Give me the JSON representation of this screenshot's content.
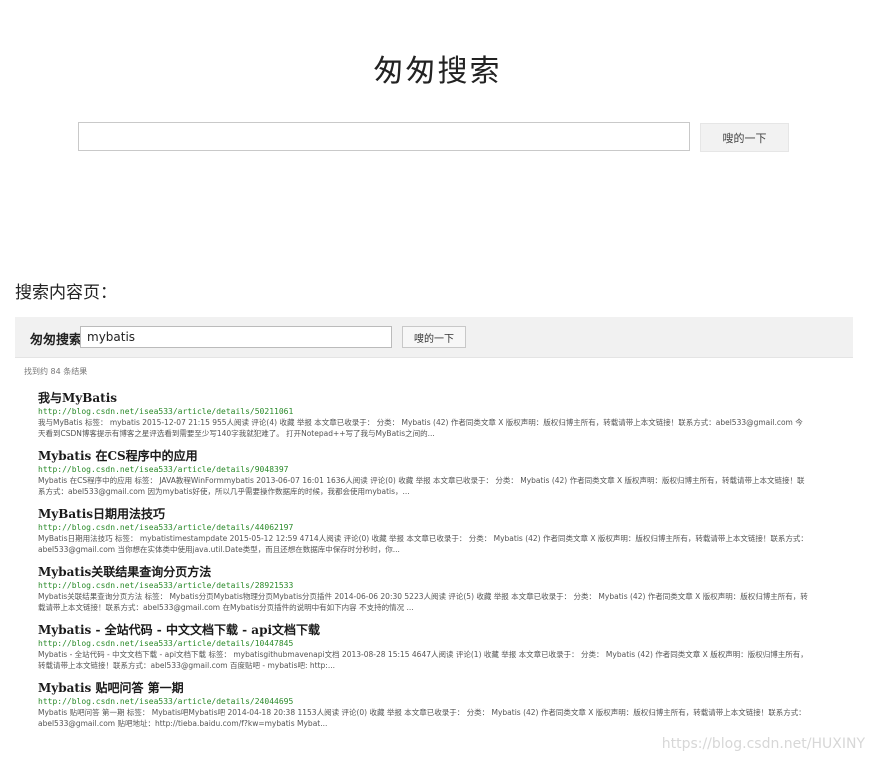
{
  "home": {
    "title": "匆匆搜索",
    "search_value": "",
    "button_label": "嗖的一下"
  },
  "section_heading": "搜索内容页：",
  "results_page": {
    "logo": "匆匆搜索",
    "query": "mybatis",
    "button_label": "嗖的一下",
    "count_text": "找到约 84 条结果",
    "results": [
      {
        "title": "我与MyBatis",
        "url": "http://blog.csdn.net/isea533/article/details/50211061",
        "snippet": "我与MyBatis 标签： mybatis 2015-12-07 21:15 955人阅读 评论(4) 收藏 举报 本文章已收录于： 分类： Mybatis (42) 作者同类文章 X 版权声明：版权归博主所有，转载请带上本文链接！联系方式：abel533@gmail.com 今天看到CSDN博客提示有博客之星评选看到需要至少写140字我就犯难了。 打开Notepad++写了我与MyBatis之间的..."
      },
      {
        "title": "Mybatis 在CS程序中的应用",
        "url": "http://blog.csdn.net/isea533/article/details/9048397",
        "snippet": "Mybatis 在CS程序中的应用 标签： JAVA教程WinFormmybatis 2013-06-07 16:01 1636人阅读 评论(0) 收藏 举报 本文章已收录于： 分类： Mybatis (42) 作者同类文章 X 版权声明：版权归博主所有，转载请带上本文链接！联系方式：abel533@gmail.com 因为mybatis好使，所以几乎需要操作数据库的时候，我都会使用mybatis，..."
      },
      {
        "title": "MyBatis日期用法技巧",
        "url": "http://blog.csdn.net/isea533/article/details/44062197",
        "snippet": "MyBatis日期用法技巧 标签： mybatistimestampdate 2015-05-12 12:59 4714人阅读 评论(0) 收藏 举报 本文章已收录于： 分类： Mybatis (42) 作者同类文章 X 版权声明：版权归博主所有，转载请带上本文链接！联系方式：abel533@gmail.com 当你想在实体类中使用java.util.Date类型，而且还想在数据库中保存时分秒时，你..."
      },
      {
        "title": "Mybatis关联结果查询分页方法",
        "url": "http://blog.csdn.net/isea533/article/details/28921533",
        "snippet": "Mybatis关联结果查询分页方法 标签： Mybatis分页Mybatis物理分页Mybatis分页插件 2014-06-06 20:30 5223人阅读 评论(5) 收藏 举报 本文章已收录于： 分类： Mybatis (42) 作者同类文章 X 版权声明：版权归博主所有，转载请带上本文链接！联系方式：abel533@gmail.com 在Mybatis分页插件的说明中有如下内容 不支持的情况 ..."
      },
      {
        "title": "Mybatis - 全站代码 - 中文文档下载 - api文档下载",
        "url": "http://blog.csdn.net/isea533/article/details/10447845",
        "snippet": "Mybatis - 全站代码 - 中文文档下载 - api文档下载 标签： mybatisgithubmavenapi文档 2013-08-28 15:15 4647人阅读 评论(1) 收藏 举报 本文章已收录于： 分类： Mybatis (42) 作者同类文章 X 版权声明：版权归博主所有，转载请带上本文链接！联系方式：abel533@gmail.com 百度贴吧 - mybatis吧: http:..."
      },
      {
        "title": "Mybatis 贴吧问答 第一期",
        "url": "http://blog.csdn.net/isea533/article/details/24044695",
        "snippet": "Mybatis 贴吧问答 第一期 标签： Mybatis吧Mybatis吧 2014-04-18 20:38 1153人阅读 评论(0) 收藏 举报 本文章已收录于： 分类： Mybatis (42) 作者同类文章 X 版权声明：版权归博主所有，转载请带上本文链接！联系方式：abel533@gmail.com 贴吧地址：http://tieba.baidu.com/f?kw=mybatis Mybat..."
      }
    ]
  },
  "watermark": "https://blog.csdn.net/HUXINY"
}
